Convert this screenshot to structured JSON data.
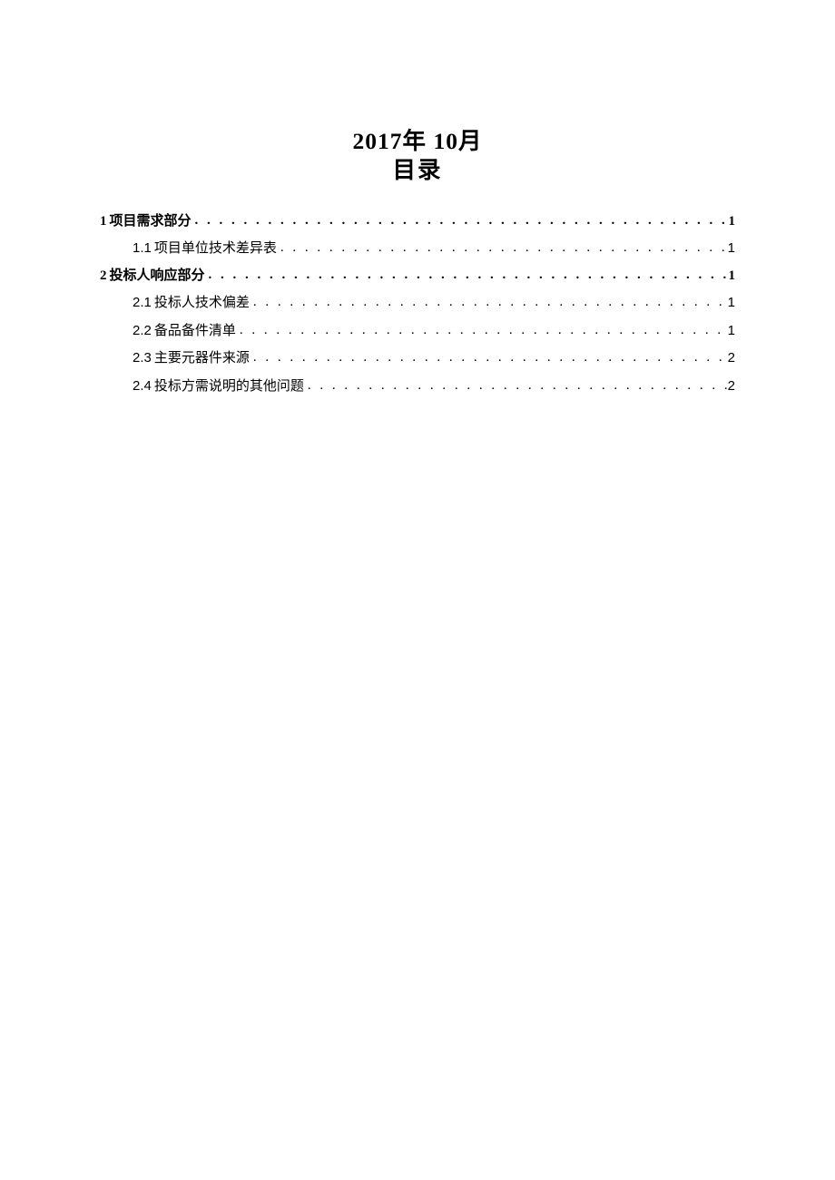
{
  "header": {
    "date_year": "2017",
    "date_year_suffix": "年",
    "date_month": "10",
    "date_month_suffix": "月",
    "toc_title": "目录"
  },
  "toc": {
    "entries": [
      {
        "level": 1,
        "number": "1",
        "title": "项目需求部分",
        "page": "1"
      },
      {
        "level": 2,
        "number": "1.1",
        "title": "项目单位技术差异表",
        "page": "1"
      },
      {
        "level": 1,
        "number": "2",
        "title": "投标人响应部分",
        "page": "1"
      },
      {
        "level": 2,
        "number": "2.1",
        "title": "投标人技术偏差",
        "page": "1"
      },
      {
        "level": 2,
        "number": "2.2",
        "title": "备品备件清单",
        "page": "1"
      },
      {
        "level": 2,
        "number": "2.3",
        "title": "主要元器件来源",
        "page": "2"
      },
      {
        "level": 2,
        "number": "2.4",
        "title": "投标方需说明的其他问题",
        "page": "2"
      }
    ]
  }
}
